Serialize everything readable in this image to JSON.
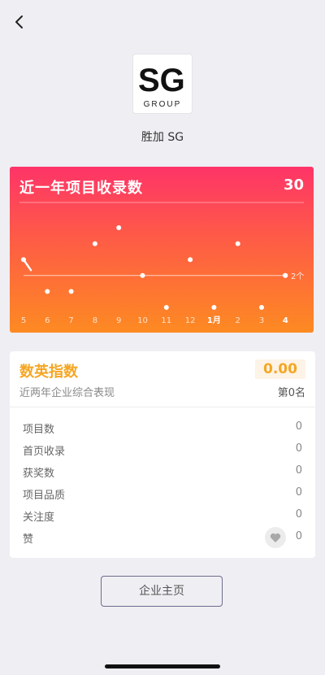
{
  "company": {
    "name": "胜加 SG",
    "logo_text": "SG",
    "logo_subtext": "GROUP"
  },
  "chart_data": {
    "type": "scatter",
    "title": "近一年项目收录数",
    "total": "30",
    "categories": [
      "5",
      "6",
      "7",
      "8",
      "9",
      "10",
      "11",
      "12",
      "1月",
      "2",
      "3",
      "4"
    ],
    "values": [
      3,
      1,
      1,
      4,
      5,
      2,
      0,
      3,
      0,
      4,
      0,
      2
    ],
    "ylim": [
      0,
      5
    ],
    "reference_line": {
      "value": 2,
      "label": "2个"
    },
    "grid": false
  },
  "score": {
    "title": "数英指数",
    "subtitle": "近两年企业综合表现",
    "value": "0.00",
    "rank": "第0名",
    "metrics": [
      {
        "label": "项目数",
        "value": "0"
      },
      {
        "label": "首页收录",
        "value": "0"
      },
      {
        "label": "获奖数",
        "value": "0"
      },
      {
        "label": "项目品质",
        "value": "0"
      },
      {
        "label": "关注度",
        "value": "0"
      },
      {
        "label": "赞",
        "value": "0"
      }
    ]
  },
  "actions": {
    "homepage_label": "企业主页"
  },
  "icons": {
    "back": "chevron-left-icon",
    "like": "heart-icon"
  },
  "colors": {
    "accent": "#f5a623",
    "chart_top": "#fe3468",
    "chart_bottom": "#fd8a22"
  }
}
